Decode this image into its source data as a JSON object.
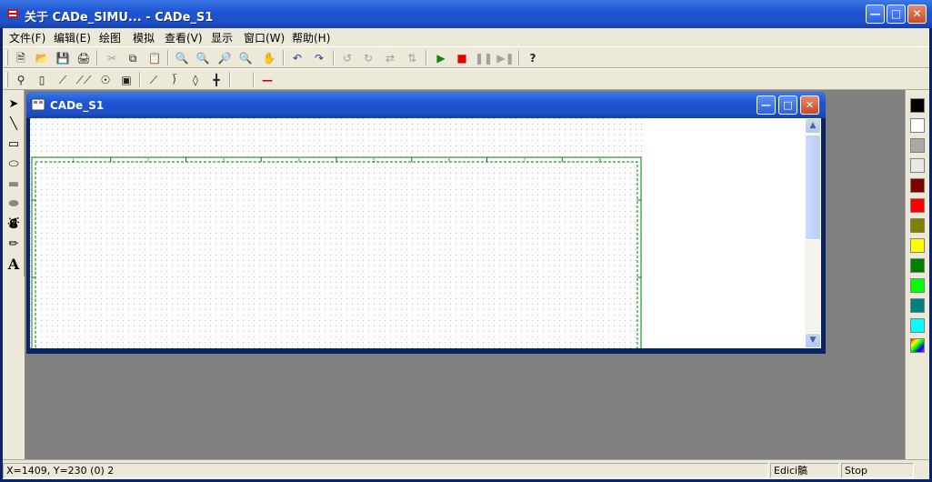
{
  "window": {
    "title": "关于 CADe_SIMU... - CADe_S1"
  },
  "menu": [
    {
      "label": "文件(F)"
    },
    {
      "label": "编辑(E)"
    },
    {
      "label": "绘图"
    },
    {
      "label": "模拟"
    },
    {
      "label": "查看(V)"
    },
    {
      "label": "显示"
    },
    {
      "label": "窗口(W)"
    },
    {
      "label": "帮助(H)"
    }
  ],
  "toolbar1": [
    "new-icon",
    "open-icon",
    "save-icon",
    "print-icon",
    "cut-icon",
    "copy-icon",
    "paste-icon",
    "zoom-in-icon",
    "zoom-out-icon",
    "zoom-window-icon",
    "zoom-all-icon",
    "pan-icon",
    "undo-icon",
    "redo-icon",
    "rotate-left-icon",
    "rotate-right-icon",
    "mirror-h-icon",
    "mirror-v-icon",
    "play-icon",
    "stop-icon",
    "pause-icon",
    "step-icon",
    "help-icon"
  ],
  "toolbar2": [
    "fuse-icon",
    "contactor-icon",
    "switch-icon",
    "three-pole-icon",
    "motor-icon",
    "relay-icon",
    "contact-no-icon",
    "contact-nc-icon",
    "diode-icon",
    "junction-icon",
    "wire-icon"
  ],
  "left_tools": [
    "arrow-icon",
    "line-icon",
    "rectangle-icon",
    "ellipse-icon",
    "filled-rect-icon",
    "filled-ellipse-icon",
    "fill-icon",
    "picker-icon",
    "text-icon"
  ],
  "left_text_tool": "A",
  "child": {
    "title": "CADe_S1"
  },
  "colors": [
    "#000000",
    "#ffffff",
    "#a8a8a8",
    "#e8e8e8",
    "#800000",
    "#ff0000",
    "#808000",
    "#ffff00",
    "#008000",
    "#00ff00",
    "#008080",
    "#00ffff",
    "multi"
  ],
  "grid_color": "#008000",
  "ruler_numbers": [
    "1",
    "2",
    "3",
    "4",
    "5",
    "6",
    "7",
    "8"
  ],
  "status": {
    "coords": "X=1409, Y=230 (0) 2",
    "mode": "Edici髇",
    "sim": "Stop"
  }
}
